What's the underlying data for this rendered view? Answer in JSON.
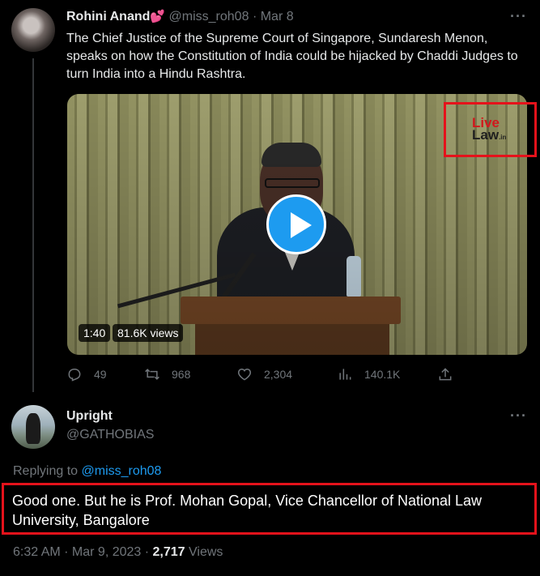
{
  "original_tweet": {
    "display_name": "Rohini Anand",
    "name_emoji": "💕",
    "handle": "@miss_roh08",
    "separator": "·",
    "date": "Mar 8",
    "more_icon": "more-horizontal-icon",
    "text": "The Chief Justice of the Supreme Court of Singapore, Sundaresh Menon, speaks on how the Constitution of India could be hijacked by Chaddi Judges to turn India into a Hindu Rashtra.",
    "video": {
      "duration": "1:40",
      "views": "81.6K views",
      "watermark_line1": "Live",
      "watermark_line2": "Law",
      "watermark_suffix": ".in",
      "play_icon": "play-icon"
    },
    "actions": {
      "replies": "49",
      "retweets": "968",
      "likes": "2,304",
      "views": "140.1K"
    }
  },
  "reply_tweet": {
    "display_name": "Upright",
    "handle": "@GATHOBIAS",
    "replying_prefix": "Replying to",
    "replying_to": "@miss_roh08",
    "text": "Good one. But he is Prof. Mohan Gopal, Vice Chancellor of National Law University, Bangalore",
    "timestamp": "6:32 AM · Mar 9, 2023 · ",
    "view_count": "2,717",
    "views_label": " Views"
  },
  "colors": {
    "background": "#000000",
    "text": "#e7e9ea",
    "muted": "#71767b",
    "accent": "#1d9bf0",
    "highlight_box": "#e5121b"
  }
}
